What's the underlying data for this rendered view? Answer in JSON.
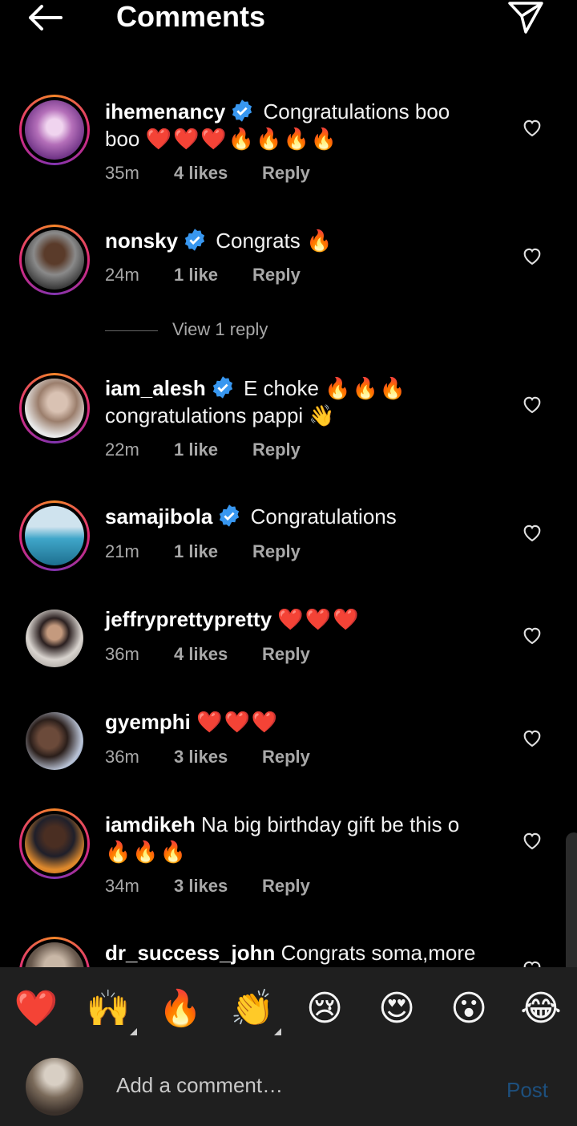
{
  "header": {
    "title": "Comments"
  },
  "comments": [
    {
      "username": "ihemenancy",
      "verified": true,
      "text": "Congratulations boo boo",
      "emojis": "❤️❤️❤️🔥🔥🔥🔥",
      "time": "35m",
      "likes": "4 likes",
      "reply": "Reply"
    },
    {
      "username": "nonsky",
      "verified": true,
      "text": "Congrats",
      "emojis": "🔥",
      "time": "24m",
      "likes": "1 like",
      "reply": "Reply"
    },
    {
      "username": "iam_alesh",
      "verified": true,
      "text": "E choke",
      "emojis": "🔥🔥🔥",
      "text2": "congratulations pappi",
      "emojis2": "👋",
      "time": "22m",
      "likes": "1 like",
      "reply": "Reply"
    },
    {
      "username": "samajibola",
      "verified": true,
      "text": "Congratulations",
      "time": "21m",
      "likes": "1 like",
      "reply": "Reply"
    },
    {
      "username": "jeffryprettypretty",
      "verified": false,
      "emojis": "❤️❤️❤️",
      "time": "36m",
      "likes": "4 likes",
      "reply": "Reply"
    },
    {
      "username": "gyemphi",
      "verified": false,
      "emojis": "❤️❤️❤️",
      "time": "36m",
      "likes": "3 likes",
      "reply": "Reply"
    },
    {
      "username": "iamdikeh",
      "verified": false,
      "text": "Na big birthday gift be this o",
      "emojis": "🔥🔥🔥",
      "time": "34m",
      "likes": "3 likes",
      "reply": "Reply"
    },
    {
      "username": "dr_success_john",
      "verified": false,
      "text": "Congrats soma,more"
    }
  ],
  "view_replies": "View 1 reply",
  "reactions": [
    "❤️",
    "🙌",
    "🔥",
    "👏",
    "😢",
    "😍",
    "😮",
    "😂"
  ],
  "composer": {
    "placeholder": "Add a comment…",
    "post_label": "Post"
  },
  "colors": {
    "background": "#000000",
    "secondary_text": "#a8a8a8",
    "verified": "#3897f0",
    "post_disabled": "#1d4f7d"
  }
}
